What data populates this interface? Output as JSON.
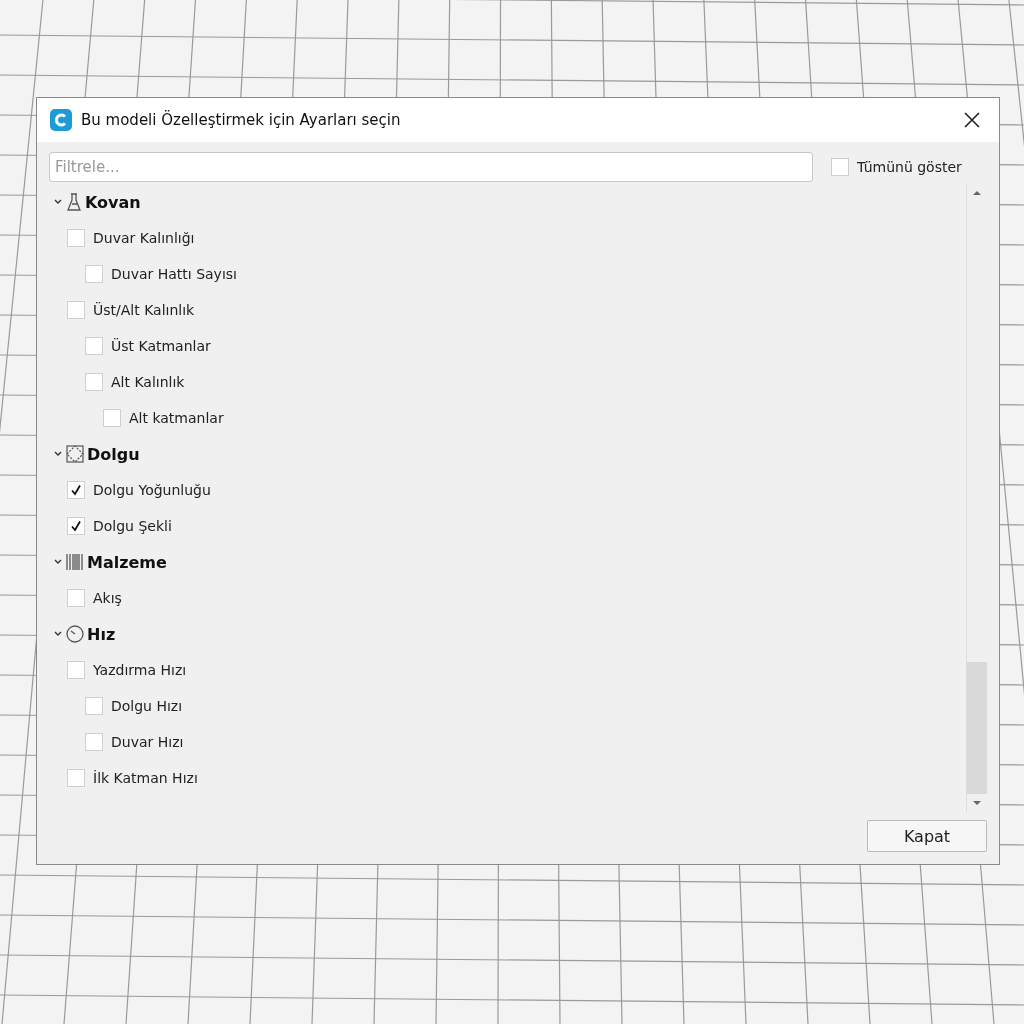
{
  "dialog": {
    "title": "Bu modeli Özelleştirmek için Ayarları seçin",
    "filter": {
      "placeholder": "Filtrele..."
    },
    "show_all": {
      "label": "Tümünü göster",
      "checked": false
    },
    "categories": [
      {
        "label": "Kovan",
        "kind": "shell",
        "expanded": true,
        "children": [
          {
            "label": "Duvar Kalınlığı",
            "checked": false,
            "children": [
              {
                "label": "Duvar Hattı Sayısı",
                "checked": false
              }
            ]
          },
          {
            "label": "Üst/Alt Kalınlık",
            "checked": false,
            "children": [
              {
                "label": "Üst Katmanlar",
                "checked": false
              },
              {
                "label": "Alt Kalınlık",
                "checked": false,
                "children": [
                  {
                    "label": "Alt katmanlar",
                    "checked": false
                  }
                ]
              }
            ]
          }
        ]
      },
      {
        "label": "Dolgu",
        "kind": "infill",
        "expanded": true,
        "children": [
          {
            "label": "Dolgu Yoğunluğu",
            "checked": true
          },
          {
            "label": "Dolgu Şekli",
            "checked": true
          }
        ]
      },
      {
        "label": "Malzeme",
        "kind": "material",
        "expanded": true,
        "children": [
          {
            "label": "Akış",
            "checked": false
          }
        ]
      },
      {
        "label": "Hız",
        "kind": "speed",
        "expanded": true,
        "children": [
          {
            "label": "Yazdırma Hızı",
            "checked": false,
            "children": [
              {
                "label": "Dolgu Hızı",
                "checked": false
              },
              {
                "label": "Duvar Hızı",
                "checked": false
              }
            ]
          },
          {
            "label": "İlk Katman Hızı",
            "checked": false
          }
        ]
      }
    ],
    "close_button": "Kapat"
  }
}
